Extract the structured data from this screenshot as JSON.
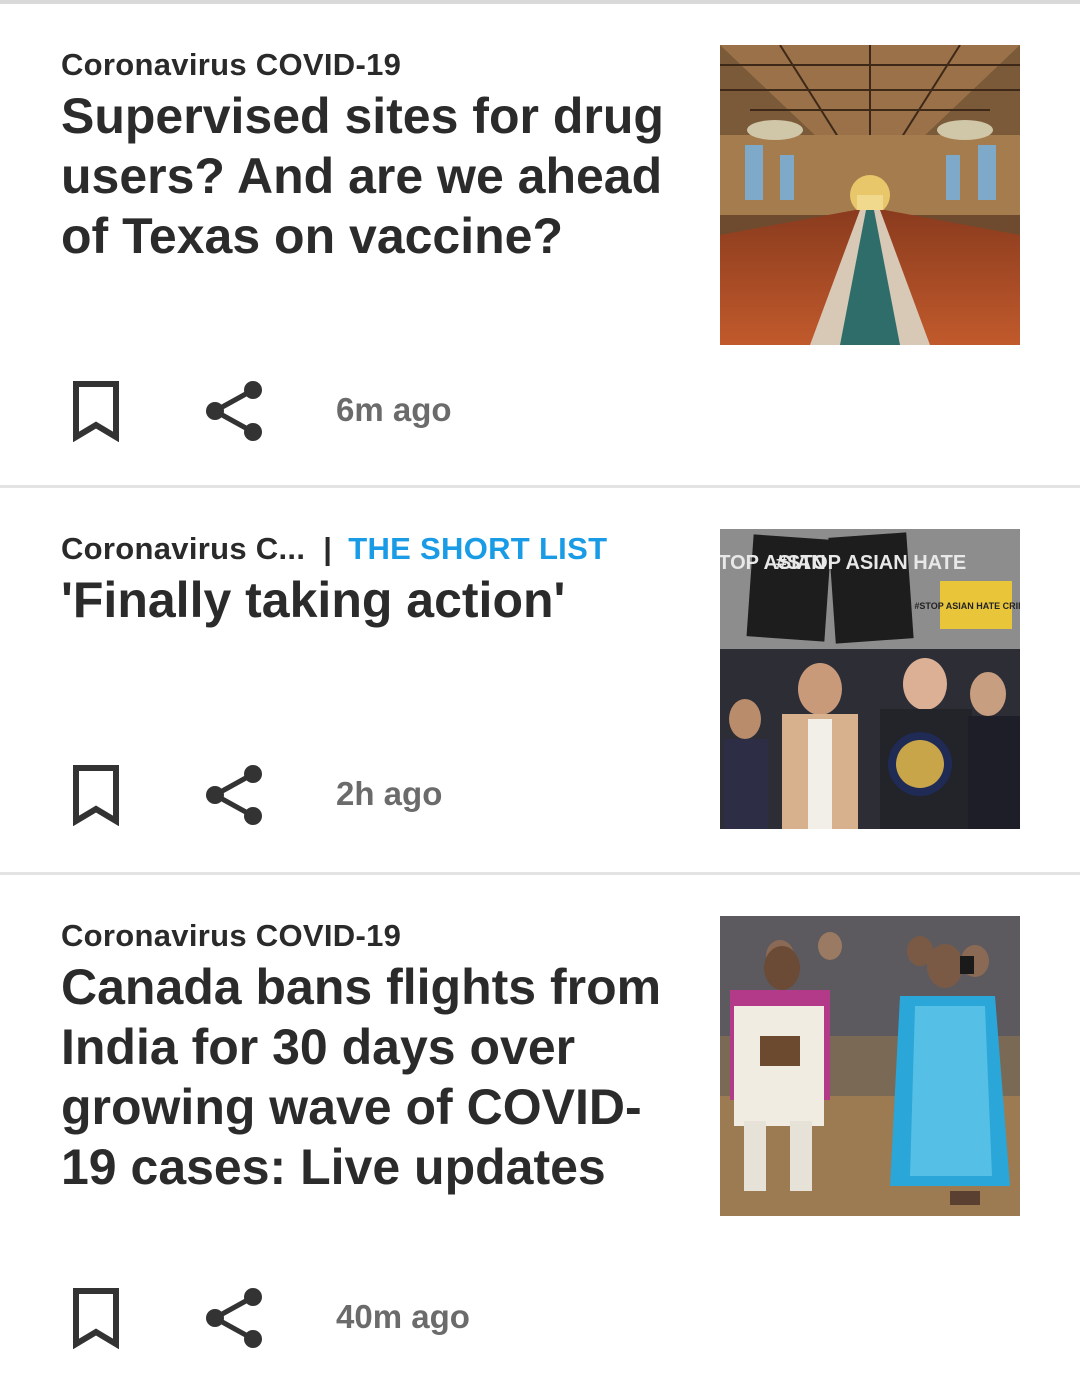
{
  "articles": [
    {
      "category": "Coronavirus COVID-19",
      "tag": "",
      "headline": "Supervised sites for drug users? And are we ahead of Texas on vaccine?",
      "time": "6m ago",
      "image": "train station hall interior"
    },
    {
      "category": "Coronavirus C...",
      "tag": "THE SHORT LIST",
      "headline": "'Finally taking action'",
      "time": "2h ago",
      "image": "rally with protest signs",
      "image_text": [
        "#STOP ASIAN HATE",
        "#STOP ASIAN HATE",
        "#STOP ASIAN HATE CRIMES"
      ]
    },
    {
      "category": "Coronavirus COVID-19",
      "tag": "",
      "headline": "Canada bans flights from India for 30 days over growing wave of COVID-19 cases: Live updates",
      "time": "40m ago",
      "image": "people seated wearing masks"
    }
  ],
  "icons": {
    "bookmark": "bookmark-icon",
    "share": "share-icon"
  },
  "colors": {
    "tag": "#1a9be6",
    "timestamp": "#6b6b6b",
    "divider": "#e3e3e3"
  }
}
